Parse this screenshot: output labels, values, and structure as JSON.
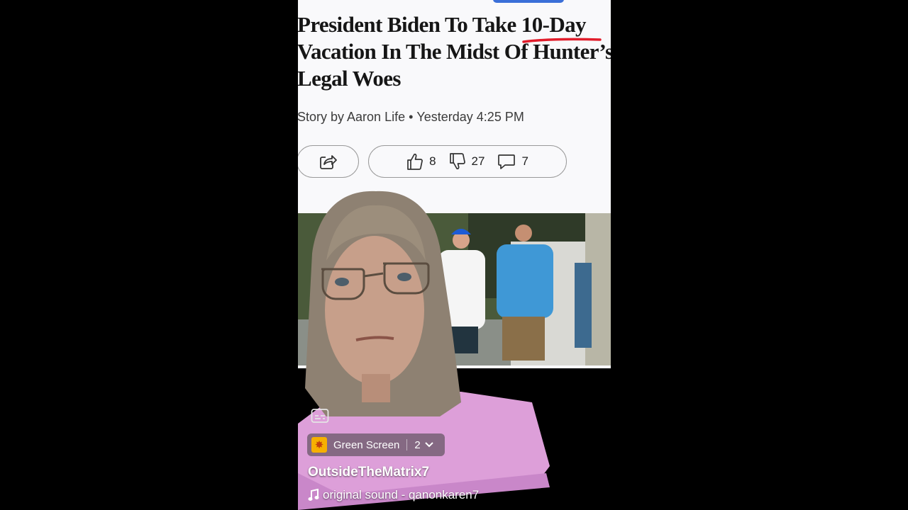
{
  "article": {
    "headline_lines": [
      "President Biden To Take 10-Day",
      "Vacation In The Midst Of Hunter’s",
      "Legal Woes"
    ],
    "byline": "Story by Aaron Life",
    "timestamp": "Yesterday 4:25 PM",
    "reactions": {
      "likes": "8",
      "dislikes": "27",
      "comments": "7"
    },
    "underline_color": "#e11d2b"
  },
  "overlay": {
    "effect_label": "Green Screen",
    "effect_count": "2",
    "username": "OutsideTheMatrix7",
    "sound": "original sound - qanonkaren7"
  },
  "icons": {
    "share": "share-icon",
    "like": "thumbs-up-icon",
    "dislike": "thumbs-down-icon",
    "comment": "comment-icon",
    "captions": "captions-icon",
    "effect": "sparkle-icon",
    "chevron": "chevron-down-icon",
    "music": "music-note-icon"
  }
}
